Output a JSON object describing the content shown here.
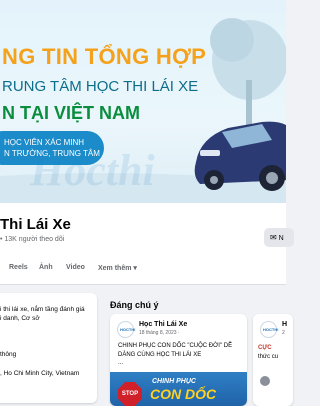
{
  "cover": {
    "title": "NG TIN TỔNG HỢP",
    "sub1": "RUNG TÂM HỌC THI LÁI XE",
    "sub2": "N TẠI VIỆT NAM",
    "pill_line1": "HỌC VIÊN XÁC MINH",
    "pill_line2": "N TRƯỜNG, TRUNG TÂM",
    "watermark": "Hocthi"
  },
  "page": {
    "name": "Thi Lái Xe",
    "likes": "• 13K người theo dõi",
    "message_button": "N"
  },
  "tabs": [
    "Reels",
    "Ảnh",
    "Video",
    "Xem thêm ▾"
  ],
  "intro": {
    "line1": "i thi lái xe, nắm tầng đánh giá",
    "line2": "i danh, Cơ sở",
    "line3": "thông",
    "line4": ", Ho Chi Minh City, Vietnam"
  },
  "featured": {
    "title": "Đáng chú ý",
    "post1": {
      "avatar_text": "HOCTHI",
      "name": "Học Thi Lái Xe",
      "date": "18 tháng 8, 2023 ·",
      "text_line1": "CHINH PHỤC CON DỐC \"CUỘC ĐỜI\" DỄ",
      "text_line2": "DÀNG CÙNG HỌC THI LÁI XE",
      "ellipsis": "...",
      "img_stop": "STOP",
      "img_text1": "CHINH PHỤC",
      "img_text2": "CON DỐC"
    },
    "post2": {
      "avatar_text": "HOCTHI",
      "name": "H",
      "date": "2",
      "text_line1": "CỰC",
      "text_line2": "thức cu"
    }
  },
  "colors": {
    "title_orange": "#f4a21b",
    "sub_teal": "#0d6e8a",
    "sub_green": "#0b8d3e",
    "pill_blue": "#1b8bc9"
  }
}
